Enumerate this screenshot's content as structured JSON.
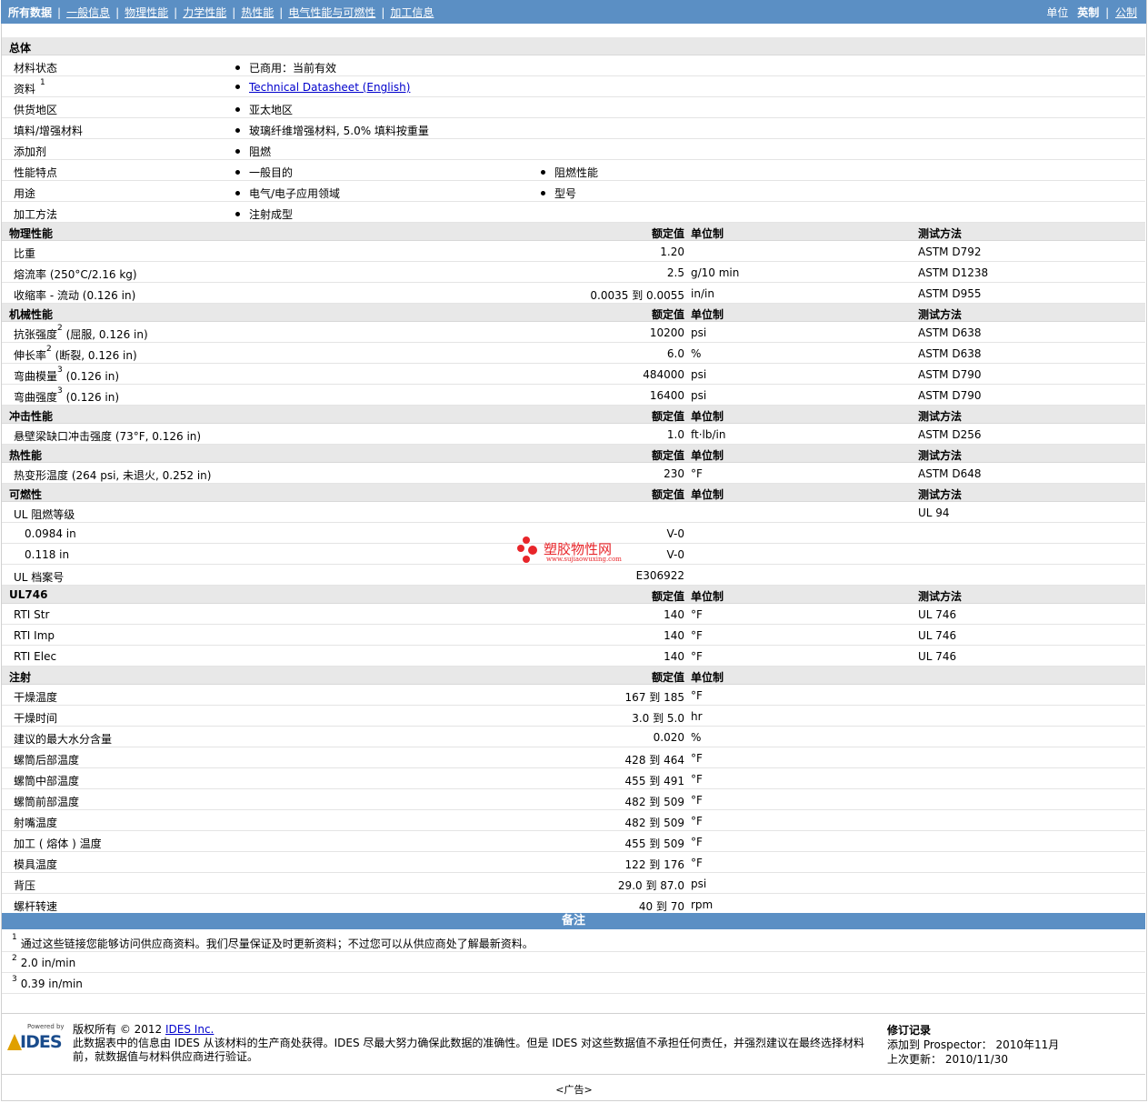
{
  "nav": {
    "tabs": [
      "所有数据",
      "一般信息",
      "物理性能",
      "力学性能",
      "热性能",
      "电气性能与可燃性",
      "加工信息"
    ],
    "units_label": "单位",
    "unit_active": "英制",
    "unit_other": "公制"
  },
  "general": {
    "title": "总体",
    "rows": [
      {
        "label": "材料状态",
        "items": [
          "已商用：当前有效"
        ]
      },
      {
        "label": "资料",
        "sup": "1",
        "items": [
          "Technical Datasheet (English)"
        ],
        "link": true
      },
      {
        "label": "供货地区",
        "items": [
          "亚太地区"
        ]
      },
      {
        "label": "填料/增强材料",
        "items": [
          "玻璃纤维增强材料, 5.0% 填料按重量"
        ]
      },
      {
        "label": "添加剂",
        "items": [
          "阻燃"
        ]
      },
      {
        "label": "性能特点",
        "items": [
          "一般目的",
          "阻燃性能"
        ]
      },
      {
        "label": "用途",
        "items": [
          "电气/电子应用领域",
          "型号"
        ]
      },
      {
        "label": "加工方法",
        "items": [
          "注射成型"
        ]
      }
    ]
  },
  "headers": {
    "value": "额定值",
    "unit": "单位制",
    "method": "测试方法"
  },
  "sections": [
    {
      "title": "物理性能",
      "method_col": true,
      "rows": [
        {
          "label": "比重",
          "value": "1.20",
          "unit": "",
          "method": "ASTM D792"
        },
        {
          "label": "熔流率  (250°C/2.16 kg)",
          "value": "2.5",
          "unit": "g/10 min",
          "method": "ASTM D1238"
        },
        {
          "label": "收缩率  - 流动  (0.126 in)",
          "value": "0.0035 到  0.0055",
          "unit": "in/in",
          "method": "ASTM D955"
        }
      ]
    },
    {
      "title": "机械性能",
      "method_col": true,
      "rows": [
        {
          "label": "抗张强度",
          "sup": "2",
          "suffix": " (屈服, 0.126 in)",
          "value": "10200",
          "unit": "psi",
          "method": "ASTM D638"
        },
        {
          "label": "伸长率",
          "sup": "2",
          "suffix": " (断裂, 0.126 in)",
          "value": "6.0",
          "unit": "%",
          "method": "ASTM D638"
        },
        {
          "label": "弯曲模量",
          "sup": "3",
          "suffix": " (0.126 in)",
          "value": "484000",
          "unit": "psi",
          "method": "ASTM D790"
        },
        {
          "label": "弯曲强度",
          "sup": "3",
          "suffix": " (0.126 in)",
          "value": "16400",
          "unit": "psi",
          "method": "ASTM D790"
        }
      ]
    },
    {
      "title": "冲击性能",
      "method_col": true,
      "rows": [
        {
          "label": "悬壁梁缺口冲击强度  (73°F, 0.126 in)",
          "value": "1.0",
          "unit": "ft·lb/in",
          "method": "ASTM D256"
        }
      ]
    },
    {
      "title": "热性能",
      "method_col": true,
      "rows": [
        {
          "label": "热变形温度  (264 psi, 未退火, 0.252 in)",
          "value": "230",
          "unit": "°F",
          "method": "ASTM D648"
        }
      ]
    },
    {
      "title": "可燃性",
      "method_col": true,
      "rows": [
        {
          "label": "UL 阻燃等级",
          "value": "",
          "unit": "",
          "method": "UL 94"
        },
        {
          "label": "0.0984 in",
          "indent": true,
          "value": "V-0",
          "unit": "",
          "method": ""
        },
        {
          "label": "0.118 in",
          "indent": true,
          "value": "V-0",
          "unit": "",
          "method": ""
        },
        {
          "label": "UL 档案号",
          "value": "E306922",
          "unit": "",
          "method": ""
        }
      ]
    },
    {
      "title": "UL746",
      "method_col": true,
      "rows": [
        {
          "label": "RTI Str",
          "value": "140",
          "unit": "°F",
          "method": "UL 746"
        },
        {
          "label": "RTI Imp",
          "value": "140",
          "unit": "°F",
          "method": "UL 746"
        },
        {
          "label": "RTI Elec",
          "value": "140",
          "unit": "°F",
          "method": "UL 746"
        }
      ]
    },
    {
      "title": "注射",
      "method_col": false,
      "rows": [
        {
          "label": "干燥温度",
          "value": "167 到  185",
          "unit": "°F",
          "method": ""
        },
        {
          "label": "干燥时间",
          "value": "3.0 到  5.0",
          "unit": "hr",
          "method": ""
        },
        {
          "label": "建议的最大水分含量",
          "value": "0.020",
          "unit": "%",
          "method": ""
        },
        {
          "label": "螺筒后部温度",
          "value": "428 到  464",
          "unit": "°F",
          "method": ""
        },
        {
          "label": "螺筒中部温度",
          "value": "455 到  491",
          "unit": "°F",
          "method": ""
        },
        {
          "label": "螺筒前部温度",
          "value": "482 到  509",
          "unit": "°F",
          "method": ""
        },
        {
          "label": "射嘴温度",
          "value": "482 到  509",
          "unit": "°F",
          "method": ""
        },
        {
          "label": "加工 ( 熔体 ) 温度",
          "value": "455 到  509",
          "unit": "°F",
          "method": ""
        },
        {
          "label": "模具温度",
          "value": "122 到  176",
          "unit": "°F",
          "method": ""
        },
        {
          "label": "背压",
          "value": "29.0 到  87.0",
          "unit": "psi",
          "method": ""
        },
        {
          "label": "螺杆转速",
          "value": "40 到  70",
          "unit": "rpm",
          "method": ""
        }
      ]
    }
  ],
  "notes": {
    "title": "备注",
    "items": [
      {
        "n": "1",
        "text": "通过这些链接您能够访问供应商资料。我们尽量保证及时更新资料；不过您可以从供应商处了解最新资料。"
      },
      {
        "n": "2",
        "text": "2.0 in/min"
      },
      {
        "n": "3",
        "text": "0.39 in/min"
      }
    ]
  },
  "watermark": {
    "cn": "塑胶物性网",
    "url": "www.sujiaowuxing.com"
  },
  "footer": {
    "logo_powered": "Powered by",
    "logo_text": "IDES",
    "copyright": "版权所有  © 2012",
    "ides_link": "IDES Inc.",
    "disclaimer": "此数据表中的信息由  IDES 从该材料的生产商处获得。IDES 尽最大努力确保此数据的准确性。但是  IDES 对这些数据值不承担任何责任，并强烈建议在最终选择材料前，就数据值与材料供应商进行验证。",
    "rev_title": "修订记录",
    "rev_added": "添加到  Prospector：  2010年11月",
    "rev_updated": "上次更新：  2010/11/30"
  },
  "ad": "<广告>"
}
